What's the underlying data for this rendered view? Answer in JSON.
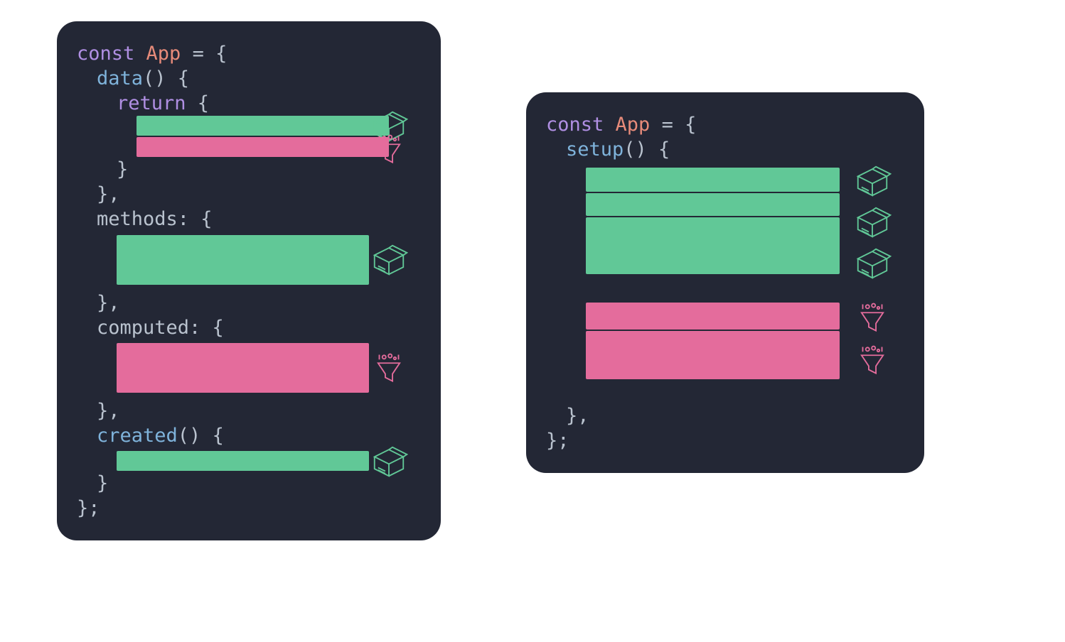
{
  "colors": {
    "bg": "#232735",
    "green": "#61c897",
    "pink": "#e46c9c",
    "keyword": "#b08fe3",
    "class": "#e78b7a",
    "function": "#7fb3db",
    "text": "#b9c2ce"
  },
  "left": {
    "line1_const": "const ",
    "line1_app": "App",
    "line1_eq": " = {",
    "data_fn": "data",
    "data_parens": "() {",
    "return_kw": "return",
    "return_brace": " {",
    "close_brace": "}",
    "close_brace_comma": "},",
    "methods_label": "methods",
    "methods_open": ": {",
    "computed_label": "computed",
    "computed_open": ": {",
    "created_fn": "created",
    "created_parens": "() {",
    "final_close": "};"
  },
  "right": {
    "line1_const": "const ",
    "line1_app": "App",
    "line1_eq": " = {",
    "setup_fn": "setup",
    "setup_parens": "() {",
    "close_brace_comma": "},",
    "final_close": "};"
  },
  "icons": {
    "box": "box-icon",
    "funnel": "funnel-icon"
  }
}
